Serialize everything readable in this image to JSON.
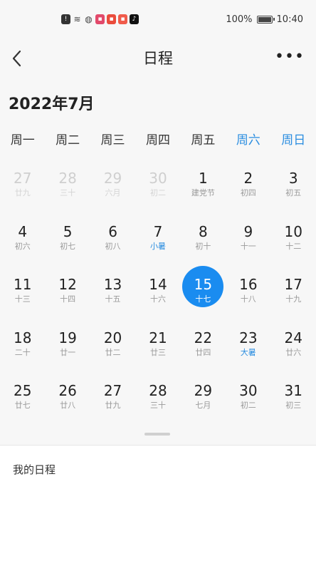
{
  "status_bar": {
    "battery_percent": "100%",
    "battery_level": 1.0,
    "time": "10:40",
    "icons": [
      "alert-icon",
      "wifi-icon",
      "globe-icon",
      "app-icon",
      "app-icon",
      "app-icon",
      "tiktok-icon"
    ]
  },
  "header": {
    "title": "日程",
    "more": "•••"
  },
  "calendar": {
    "month_title": "2022年7月",
    "weekdays": [
      "周一",
      "周二",
      "周三",
      "周四",
      "周五",
      "周六",
      "周日"
    ],
    "weekend_color": "#2a8de0",
    "selected_color": "#1a8cf0",
    "weeks": [
      [
        {
          "day": "27",
          "lunar": "廿九",
          "prev": true
        },
        {
          "day": "28",
          "lunar": "三十",
          "prev": true
        },
        {
          "day": "29",
          "lunar": "六月",
          "prev": true
        },
        {
          "day": "30",
          "lunar": "初二",
          "prev": true
        },
        {
          "day": "1",
          "lunar": "建党节"
        },
        {
          "day": "2",
          "lunar": "初四"
        },
        {
          "day": "3",
          "lunar": "初五"
        }
      ],
      [
        {
          "day": "4",
          "lunar": "初六"
        },
        {
          "day": "5",
          "lunar": "初七"
        },
        {
          "day": "6",
          "lunar": "初八"
        },
        {
          "day": "7",
          "lunar": "小暑",
          "term": true
        },
        {
          "day": "8",
          "lunar": "初十"
        },
        {
          "day": "9",
          "lunar": "十一"
        },
        {
          "day": "10",
          "lunar": "十二"
        }
      ],
      [
        {
          "day": "11",
          "lunar": "十三"
        },
        {
          "day": "12",
          "lunar": "十四"
        },
        {
          "day": "13",
          "lunar": "十五"
        },
        {
          "day": "14",
          "lunar": "十六"
        },
        {
          "day": "15",
          "lunar": "十七",
          "selected": true
        },
        {
          "day": "16",
          "lunar": "十八"
        },
        {
          "day": "17",
          "lunar": "十九"
        }
      ],
      [
        {
          "day": "18",
          "lunar": "二十"
        },
        {
          "day": "19",
          "lunar": "廿一"
        },
        {
          "day": "20",
          "lunar": "廿二"
        },
        {
          "day": "21",
          "lunar": "廿三"
        },
        {
          "day": "22",
          "lunar": "廿四"
        },
        {
          "day": "23",
          "lunar": "大暑",
          "term": true
        },
        {
          "day": "24",
          "lunar": "廿六"
        }
      ],
      [
        {
          "day": "25",
          "lunar": "廿七"
        },
        {
          "day": "26",
          "lunar": "廿八"
        },
        {
          "day": "27",
          "lunar": "廿九"
        },
        {
          "day": "28",
          "lunar": "三十"
        },
        {
          "day": "29",
          "lunar": "七月"
        },
        {
          "day": "30",
          "lunar": "初二"
        },
        {
          "day": "31",
          "lunar": "初三"
        }
      ]
    ]
  },
  "schedule": {
    "label": "我的日程"
  }
}
